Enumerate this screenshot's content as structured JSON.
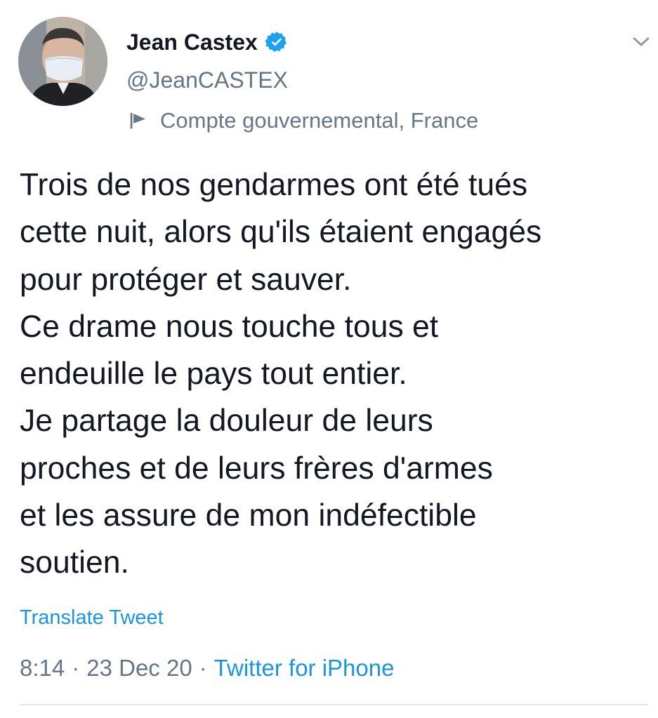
{
  "tweet": {
    "author": {
      "display_name": "Jean Castex",
      "handle": "@JeanCASTEX",
      "verified": true,
      "account_label": "Compte gouvernemental, France",
      "avatar_icon": "user-avatar-photo",
      "verified_icon": "verified-badge-icon",
      "label_icon": "flag-icon"
    },
    "menu_icon": "chevron-down-icon",
    "text_lines": [
      "Trois de nos gendarmes ont été tués",
      "cette nuit, alors qu'ils étaient engagés",
      "pour protéger et sauver.",
      "Ce drame nous touche tous et",
      "endeuille le pays tout entier.",
      "Je partage la douleur de leurs",
      "proches et de leurs frères d'armes",
      "et les assure de mon indéfectible",
      "soutien."
    ],
    "translate_label": "Translate Tweet",
    "meta": {
      "time": "8:14",
      "separator": "·",
      "date": "23 Dec 20",
      "source": "Twitter for iPhone"
    }
  },
  "colors": {
    "text_primary": "#141823",
    "text_secondary": "#657786",
    "link": "#1b95e0",
    "verified": "#1da1f2",
    "divider": "#e1e8ed"
  }
}
